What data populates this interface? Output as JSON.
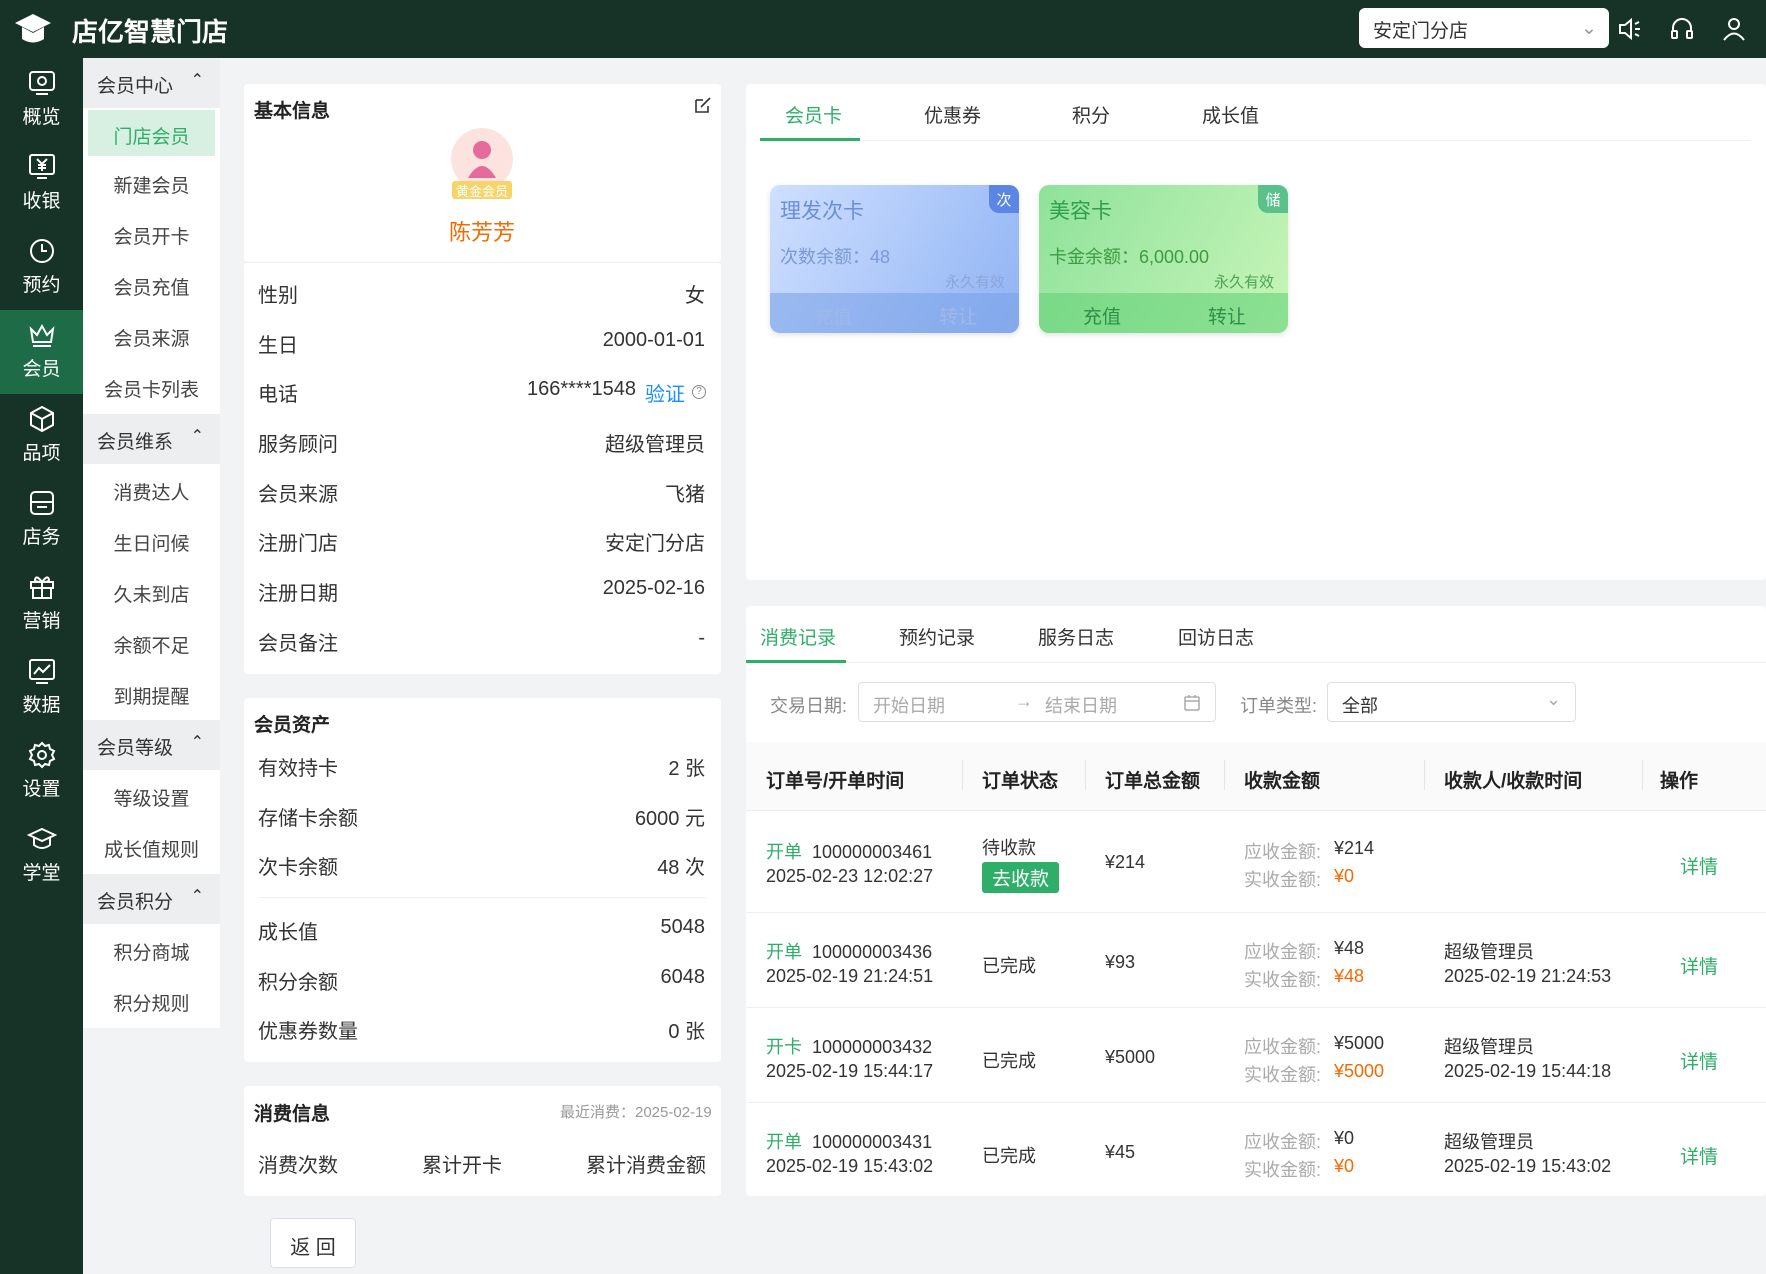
{
  "app": {
    "title": "店亿智慧门店",
    "store": "安定门分店"
  },
  "nav": [
    {
      "label": "概览",
      "icon": "overview-icon"
    },
    {
      "label": "收银",
      "icon": "cashier-icon"
    },
    {
      "label": "预约",
      "icon": "clock-icon"
    },
    {
      "label": "会员",
      "icon": "crown-icon"
    },
    {
      "label": "品项",
      "icon": "cube-icon"
    },
    {
      "label": "店务",
      "icon": "store-icon"
    },
    {
      "label": "营销",
      "icon": "gift-icon"
    },
    {
      "label": "数据",
      "icon": "chart-icon"
    },
    {
      "label": "设置",
      "icon": "gear-icon"
    },
    {
      "label": "学堂",
      "icon": "graduation-icon"
    }
  ],
  "submenu": {
    "g1": "会员中心",
    "g1_items": [
      "门店会员",
      "新建会员",
      "会员开卡",
      "会员充值",
      "会员来源",
      "会员卡列表"
    ],
    "g2": "会员维系",
    "g2_items": [
      "消费达人",
      "生日问候",
      "久未到店",
      "余额不足",
      "到期提醒"
    ],
    "g3": "会员等级",
    "g3_items": [
      "等级设置",
      "成长值规则"
    ],
    "g4": "会员积分",
    "g4_items": [
      "积分商城",
      "积分规则"
    ]
  },
  "basic": {
    "title": "基本信息",
    "level_badge": "黄金会员",
    "name": "陈芳芳",
    "rows": [
      {
        "label": "性别",
        "value": "女"
      },
      {
        "label": "生日",
        "value": "2000-01-01"
      },
      {
        "label": "电话",
        "value": "166****1548"
      },
      {
        "label": "服务顾问",
        "value": "超级管理员"
      },
      {
        "label": "会员来源",
        "value": "飞猪"
      },
      {
        "label": "注册门店",
        "value": "安定门分店"
      },
      {
        "label": "注册日期",
        "value": "2025-02-16"
      },
      {
        "label": "会员备注",
        "value": "-"
      }
    ],
    "verify": "验证"
  },
  "assets": {
    "title": "会员资产",
    "rows": [
      {
        "label": "有效持卡",
        "value": "2 张"
      },
      {
        "label": "存储卡余额",
        "value": "6000 元"
      },
      {
        "label": "次卡余额",
        "value": "48 次"
      },
      {
        "label": "成长值",
        "value": "5048"
      },
      {
        "label": "积分余额",
        "value": "6048"
      },
      {
        "label": "优惠券数量",
        "value": "0 张"
      }
    ]
  },
  "consume": {
    "title": "消费信息",
    "last": "最近消费：2025-02-19",
    "cols": [
      "消费次数",
      "累计开卡",
      "累计消费金额"
    ]
  },
  "card_tabs": [
    "会员卡",
    "优惠券",
    "积分",
    "成长值"
  ],
  "cards": [
    {
      "name": "理发次卡",
      "corner": "次",
      "balance": "次数余额：48",
      "valid": "永久有效",
      "btn1": "充值",
      "btn2": "转让"
    },
    {
      "name": "美容卡",
      "corner": "储",
      "balance": "卡金余额：6,000.00",
      "valid": "永久有效",
      "btn1": "充值",
      "btn2": "转让"
    }
  ],
  "record_tabs": [
    "消费记录",
    "预约记录",
    "服务日志",
    "回访日志"
  ],
  "filter": {
    "date_label": "交易日期:",
    "start_ph": "开始日期",
    "end_ph": "结束日期",
    "type_label": "订单类型:",
    "type_value": "全部"
  },
  "table": {
    "headers": [
      "订单号/开单时间",
      "订单状态",
      "订单总金额",
      "收款金额",
      "收款人/收款时间",
      "操作"
    ],
    "due_label": "应收金额:",
    "paid_label": "实收金额:",
    "detail": "详情",
    "rows": [
      {
        "type": "开单",
        "no": "100000003461",
        "time": "2025-02-23 12:02:27",
        "status": "待收款",
        "action": "去收款",
        "total": "¥214",
        "due": "¥214",
        "paid": "¥0",
        "payee": "",
        "pay_time": ""
      },
      {
        "type": "开单",
        "no": "100000003436",
        "time": "2025-02-19 21:24:51",
        "status": "已完成",
        "action": "",
        "total": "¥93",
        "due": "¥48",
        "paid": "¥48",
        "payee": "超级管理员",
        "pay_time": "2025-02-19 21:24:53"
      },
      {
        "type": "开卡",
        "no": "100000003432",
        "time": "2025-02-19 15:44:17",
        "status": "已完成",
        "action": "",
        "total": "¥5000",
        "due": "¥5000",
        "paid": "¥5000",
        "payee": "超级管理员",
        "pay_time": "2025-02-19 15:44:18"
      },
      {
        "type": "开单",
        "no": "100000003431",
        "time": "2025-02-19 15:43:02",
        "status": "已完成",
        "action": "",
        "total": "¥45",
        "due": "¥0",
        "paid": "¥0",
        "payee": "超级管理员",
        "pay_time": "2025-02-19 15:43:02"
      }
    ]
  },
  "back": "返 回"
}
